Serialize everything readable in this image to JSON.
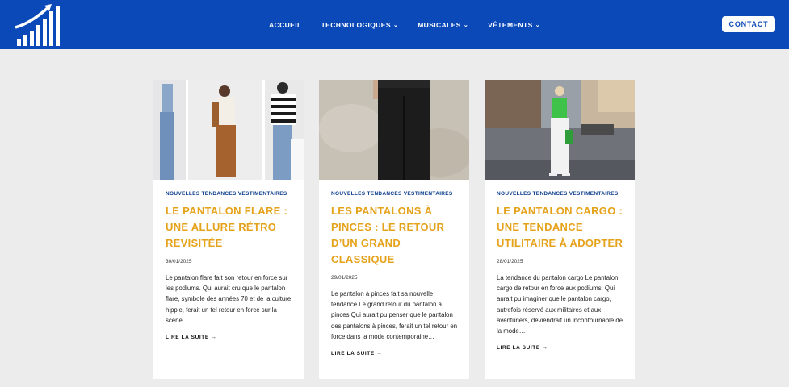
{
  "header": {
    "nav": [
      {
        "label": "ACCUEIL",
        "has_dropdown": false
      },
      {
        "label": "TECHNOLOGIQUES",
        "has_dropdown": true
      },
      {
        "label": "MUSICALES",
        "has_dropdown": true
      },
      {
        "label": "VÊTEMENTS",
        "has_dropdown": true
      }
    ],
    "contact_label": "CONTACT",
    "dropdown_icon": "⌄"
  },
  "colors": {
    "header_bg": "#0b49b8",
    "title": "#e5a21b",
    "category": "#0b3c8c",
    "page_bg": "#ececec"
  },
  "articles": [
    {
      "category": "NOUVELLES TENDANCES VESTIMENTAIRES",
      "title": "LE PANTALON FLARE : UNE ALLURE RÉTRO REVISITÉE",
      "date": "30/01/2025",
      "excerpt": "Le pantalon flare fait son retour en force sur les podiums. Qui aurait cru que le pantalon flare, symbole des années 70 et de la culture hippie, ferait un tel retour en force sur la scène…",
      "more": "LIRE LA SUITE →"
    },
    {
      "category": "NOUVELLES TENDANCES VESTIMENTAIRES",
      "title": "LES PANTALONS À PINCES : LE RETOUR D’UN GRAND CLASSIQUE",
      "date": "29/01/2025",
      "excerpt": "Le pantalon à pinces fait sa nouvelle tendance Le grand retour du pantalon à pinces Qui aurait pu penser que le pantalon des pantalons à pinces, ferait un tel retour en force dans la mode contemporaine…",
      "more": "LIRE LA SUITE →"
    },
    {
      "category": "NOUVELLES TENDANCES VESTIMENTAIRES",
      "title": "LE PANTALON CARGO : UNE TENDANCE UTILITAIRE À ADOPTER",
      "date": "28/01/2025",
      "excerpt": "La tendance du pantalon cargo Le pantalon cargo de retour en force aux podiums. Qui aurait pu imaginer que le pantalon cargo, autrefois réservé aux militaires et aux aventuriers, deviendrait un incontournable de la mode…",
      "more": "LIRE LA SUITE →"
    }
  ]
}
